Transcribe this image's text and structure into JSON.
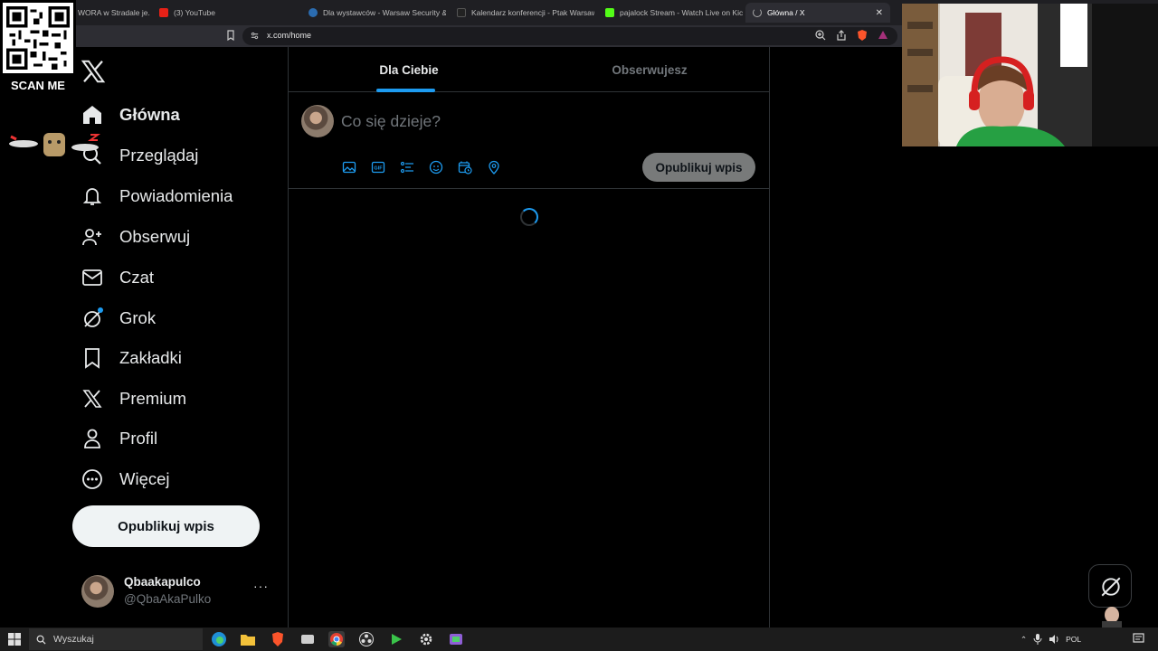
{
  "browser": {
    "tabs": [
      {
        "label": "WORA w Stradale je...",
        "favicon": "stradale-favicon"
      },
      {
        "label": "(3) YouTube",
        "favicon": "youtube-favicon"
      },
      {
        "label": "Dla wystawców - Warsaw Security &",
        "favicon": "warsaw-security-favicon"
      },
      {
        "label": "Kalendarz konferencji - Ptak Warsaw",
        "favicon": "ptak-favicon"
      },
      {
        "label": "pajalock Stream - Watch Live on Kick",
        "favicon": "kick-favicon"
      },
      {
        "label": "Główna / X",
        "favicon": "loading-icon",
        "active": true
      }
    ],
    "url": "x.com/home"
  },
  "overlay": {
    "qr_label": "SCAN ME"
  },
  "sidebar": {
    "items": [
      {
        "label": "Główna",
        "icon": "home-icon",
        "active": true
      },
      {
        "label": "Przeglądaj",
        "icon": "search-icon"
      },
      {
        "label": "Powiadomienia",
        "icon": "bell-icon"
      },
      {
        "label": "Obserwuj",
        "icon": "follow-icon"
      },
      {
        "label": "Czat",
        "icon": "mail-icon"
      },
      {
        "label": "Grok",
        "icon": "grok-icon"
      },
      {
        "label": "Zakładki",
        "icon": "bookmark-icon"
      },
      {
        "label": "Premium",
        "icon": "x-icon"
      },
      {
        "label": "Profil",
        "icon": "person-icon"
      },
      {
        "label": "Więcej",
        "icon": "more-icon"
      }
    ],
    "post_button": "Opublikuj wpis",
    "account": {
      "name": "Qbaakapulco",
      "handle": "@QbaAkaPulko",
      "more": "···"
    }
  },
  "feed": {
    "tabs": [
      {
        "label": "Dla Ciebie",
        "active": true
      },
      {
        "label": "Obserwujesz"
      }
    ],
    "composer": {
      "placeholder": "Co się dzieje?",
      "tools": [
        "image-icon",
        "gif-icon",
        "poll-icon",
        "emoji-icon",
        "schedule-icon",
        "location-icon"
      ],
      "publish_label": "Opublikuj wpis"
    }
  },
  "taskbar": {
    "search_placeholder": "Wyszukaj",
    "apps": [
      "edge-icon",
      "explorer-icon",
      "brave-icon",
      "app-icon",
      "chrome-icon",
      "obs-icon",
      "media-icon",
      "settings-icon",
      "game-icon"
    ],
    "tray": {
      "lang": "POL"
    }
  },
  "colors": {
    "accent": "#1d9bf0",
    "background": "#000000",
    "text": "#e7e9ea",
    "muted": "#71767b",
    "border": "#2f3336"
  }
}
